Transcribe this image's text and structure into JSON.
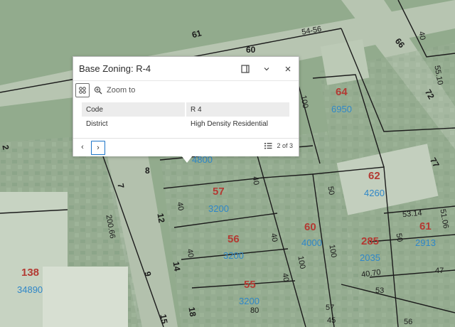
{
  "popup": {
    "title": "Base Zoning: R-4",
    "zoom_label": "Zoom to",
    "rows": [
      {
        "key": "Code",
        "value": "R 4"
      },
      {
        "key": "District",
        "value": "High Density Residential"
      }
    ],
    "pager": "2 of 3",
    "prev_glyph": "‹",
    "next_glyph": "›"
  },
  "map": {
    "streets": [
      "60",
      "61",
      "66",
      "72",
      "77",
      "8",
      "7",
      "12",
      "9",
      "14",
      "15",
      "18",
      "2"
    ],
    "lot_sizes": [
      "54-56",
      "40",
      "50",
      "100",
      "200.66",
      "40.70",
      "53.14",
      "51.06",
      "47",
      "53",
      "56",
      "57",
      "80",
      "45",
      "55.10"
    ],
    "parcels": [
      {
        "num": "64",
        "area": "6950"
      },
      {
        "num": "62",
        "area": "4260"
      },
      {
        "num": "57",
        "area": "3200"
      },
      {
        "num": "56",
        "area": "3200"
      },
      {
        "num": "60",
        "area": "4000"
      },
      {
        "num": "285",
        "area": "2035"
      },
      {
        "num": "61",
        "area": "2913"
      },
      {
        "num": "55",
        "area": "3200"
      },
      {
        "num": "138",
        "area": "34890"
      }
    ],
    "partial_area": "4800",
    "colors": {
      "parcel_num": "#b33a33",
      "parcel_area": "#2f87c8",
      "dim": "#1b1b1b",
      "boundary": "#1b1b1b"
    }
  }
}
